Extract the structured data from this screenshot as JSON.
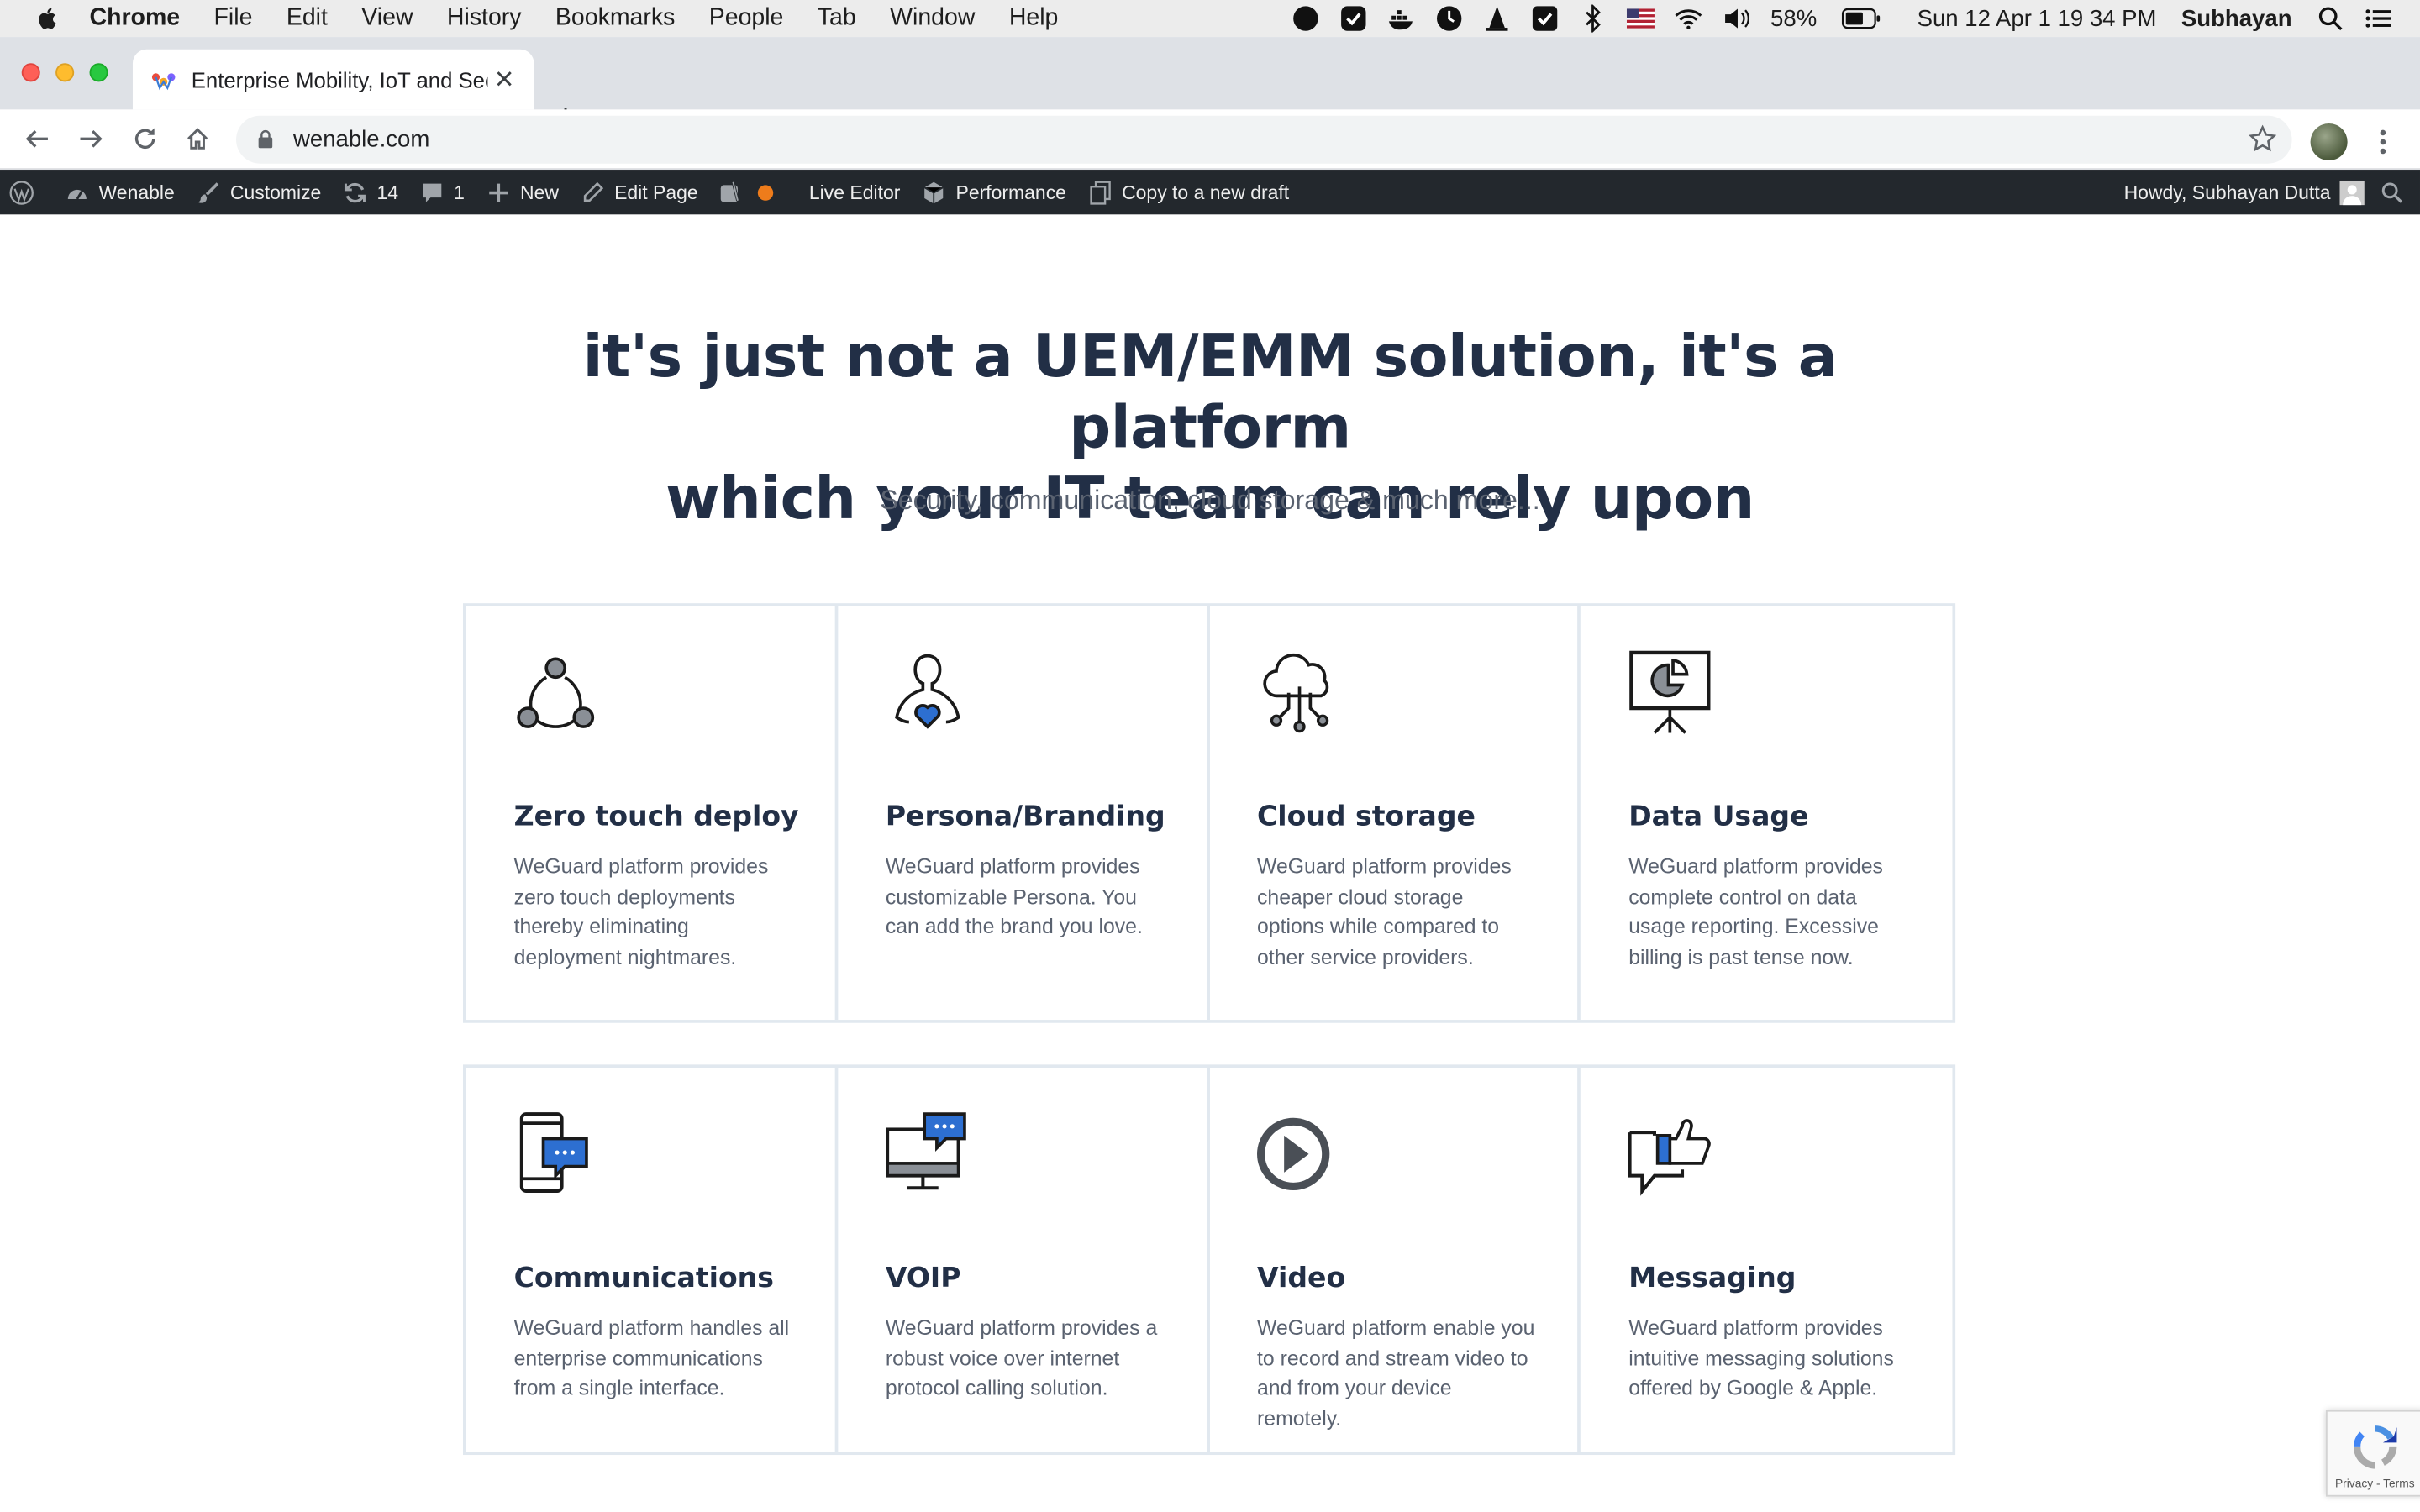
{
  "menubar": {
    "app": "Chrome",
    "items": [
      "File",
      "Edit",
      "View",
      "History",
      "Bookmarks",
      "People",
      "Tab",
      "Window",
      "Help"
    ],
    "battery": "58%",
    "datetime": "Sun 12 Apr  1 19 34 PM",
    "user": "Subhayan"
  },
  "browser": {
    "tab_title": "Enterprise Mobility, IoT and Security",
    "url": "wenable.com"
  },
  "adminbar": {
    "site": "Wenable",
    "customize": "Customize",
    "updates": "14",
    "comments": "1",
    "new": "New",
    "edit_page": "Edit Page",
    "live_editor": "Live Editor",
    "performance": "Performance",
    "copy_draft": "Copy to a new draft",
    "howdy": "Howdy, Subhayan Dutta"
  },
  "hero": {
    "line1": "it's just not a UEM/EMM solution, it's a platform",
    "line2": "which your IT team can rely upon",
    "subtitle": "Security, communication, cloud storage & much more..."
  },
  "features": [
    {
      "icon": "network-nodes-icon",
      "title": "Zero touch deploy",
      "desc": "WeGuard platform provides zero touch deployments thereby eliminating deployment nightmares."
    },
    {
      "icon": "person-heart-icon",
      "title": "Persona/Branding",
      "desc": "WeGuard platform provides customizable Persona. You can add the brand you love."
    },
    {
      "icon": "cloud-circuit-icon",
      "title": "Cloud storage",
      "desc": "WeGuard platform provides cheaper cloud storage options while compared to other service providers."
    },
    {
      "icon": "presentation-chart-icon",
      "title": "Data Usage",
      "desc": "WeGuard platform provides complete control on data usage reporting. Excessive billing is past tense now."
    },
    {
      "icon": "phone-chat-icon",
      "title": "Communications",
      "desc": "WeGuard platform handles all enterprise communications from a single interface."
    },
    {
      "icon": "monitor-chat-icon",
      "title": "VOIP",
      "desc": "WeGuard platform provides a robust voice over internet protocol calling solution."
    },
    {
      "icon": "play-circle-icon",
      "title": "Video",
      "desc": "WeGuard platform enable you to record and stream video to and from your device remotely."
    },
    {
      "icon": "thumbs-up-chat-icon",
      "title": "Messaging",
      "desc": "WeGuard platform provides intuitive messaging solutions offered by Google & Apple."
    }
  ],
  "recaptcha": {
    "text": "Privacy - Terms"
  },
  "colors": {
    "heading": "#222f46",
    "body": "#5a6270",
    "accent_blue": "#2d6fd1",
    "admin_bar": "#23282d",
    "border": "#e1e8ef"
  }
}
